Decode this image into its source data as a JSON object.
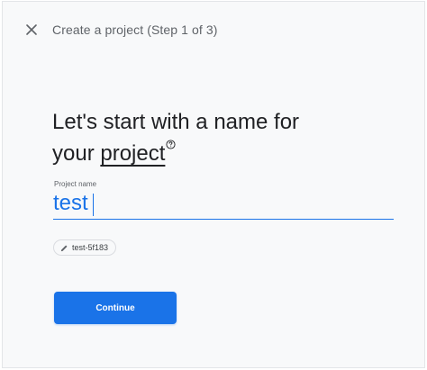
{
  "header": {
    "close_icon": "close-icon",
    "step_title": "Create a project (Step 1 of 3)"
  },
  "main": {
    "heading_part1": "Let's start with a name for",
    "heading_part2_prefix": "your ",
    "heading_part2_underlined": "project",
    "help_icon": "help-circle-icon",
    "project_name_field": {
      "label": "Project name",
      "value": "test"
    },
    "project_id_chip": {
      "icon": "pencil-icon",
      "label": "test-5f183"
    },
    "continue_label": "Continue"
  },
  "colors": {
    "accent": "#1a73e8",
    "background": "#f8f9fa",
    "text_primary": "#202124",
    "text_secondary": "#5f6368"
  }
}
